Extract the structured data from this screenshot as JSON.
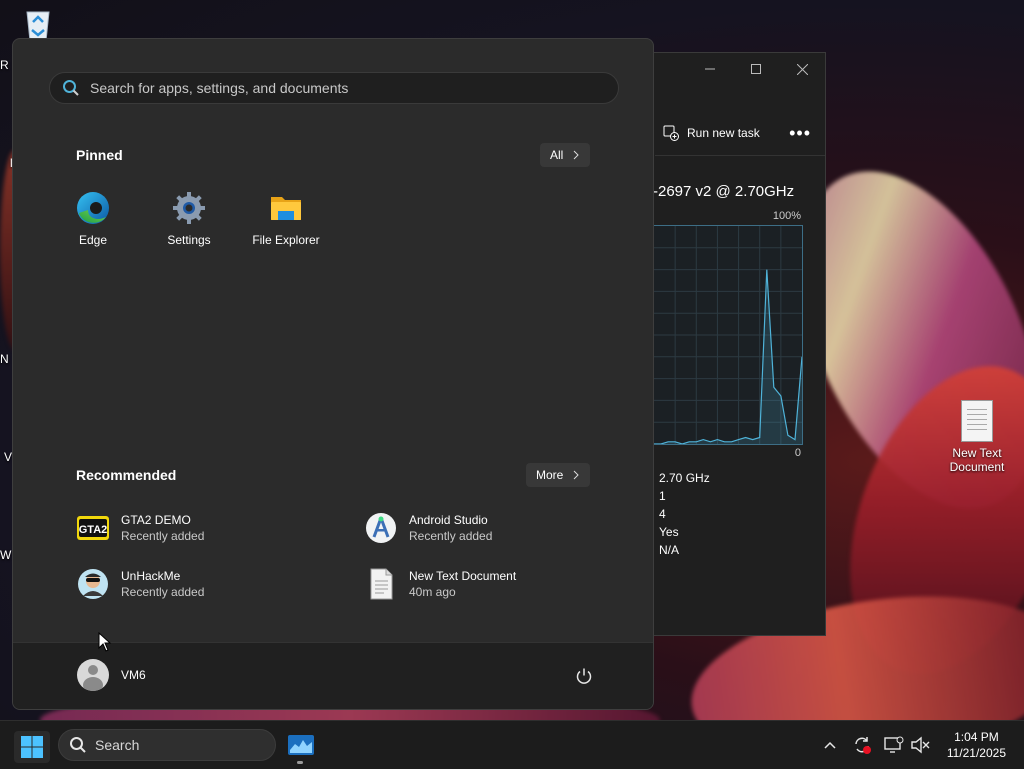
{
  "desktop": {
    "icons": [
      {
        "name": "recycle-bin",
        "label": ""
      },
      {
        "name": "new-text-document",
        "label": "New Text Document"
      }
    ],
    "edge_letters": [
      "R",
      "N",
      "V",
      "W",
      "l"
    ]
  },
  "task_manager": {
    "run_new_task": "Run new task",
    "more": "•••",
    "cpu_name": "-2697 v2 @ 2.70GHz",
    "scale_max": "100%",
    "scale_min": "0",
    "values": [
      "2.70 GHz",
      "1",
      "4",
      "Yes",
      "N/A"
    ],
    "graph_series": [
      0,
      0,
      1,
      1,
      0,
      1,
      1,
      2,
      1,
      2,
      1,
      1,
      2,
      3,
      2,
      3,
      80,
      26,
      22,
      4,
      2,
      40
    ],
    "graph_color": "#4fb3d9"
  },
  "start_menu": {
    "search": {
      "placeholder": "Search for apps, settings, and documents"
    },
    "pinned": {
      "title": "Pinned",
      "all_button": "All",
      "apps": [
        {
          "label": "Edge",
          "icon": "edge-icon"
        },
        {
          "label": "Settings",
          "icon": "settings-gear-icon"
        },
        {
          "label": "File Explorer",
          "icon": "folder-icon"
        }
      ]
    },
    "recommended": {
      "title": "Recommended",
      "more_button": "More",
      "items": [
        {
          "name": "GTA2 DEMO",
          "sub": "Recently added",
          "icon": "gta2-icon"
        },
        {
          "name": "Android Studio",
          "sub": "Recently added",
          "icon": "android-studio-icon"
        },
        {
          "name": "UnHackMe",
          "sub": "Recently added",
          "icon": "unhackme-icon"
        },
        {
          "name": "New Text Document",
          "sub": "40m ago",
          "icon": "text-document-icon"
        }
      ]
    },
    "user": {
      "name": "VM6"
    }
  },
  "taskbar": {
    "search_label": "Search",
    "clock": {
      "time": "1:04 PM",
      "date": "11/21/2025"
    }
  },
  "colors": {
    "accent": "#0078d4",
    "start_bg": "#2b2b2b",
    "taskbar_bg": "#1c1c1c"
  }
}
